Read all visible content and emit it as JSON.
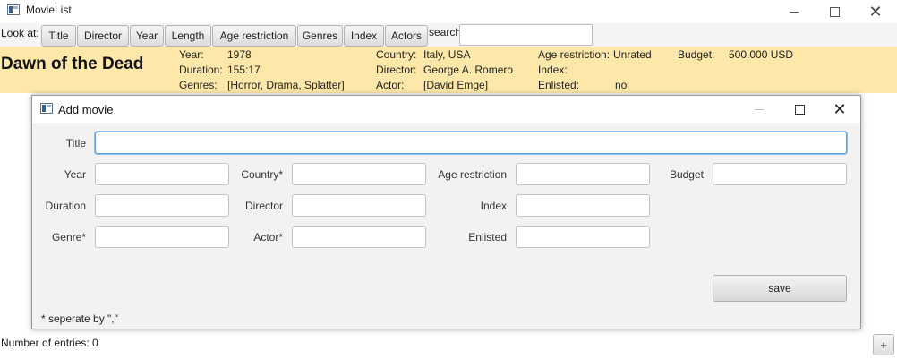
{
  "window": {
    "title": "MovieList",
    "icon": "app-window-icon",
    "controls": {
      "minimize": "minimize-icon",
      "maximize": "maximize-icon",
      "close": "✕"
    }
  },
  "toolbar": {
    "look_at_label": "Look at:",
    "buttons": [
      "Title",
      "Director",
      "Year",
      "Length",
      "Age restriction",
      "Genres",
      "Index",
      "Actors"
    ],
    "search_label": "search",
    "search_value": ""
  },
  "movie": {
    "title": "Dawn of the Dead",
    "year_label": "Year:",
    "year": "1978",
    "duration_label": "Duration:",
    "duration": "155:17",
    "genres_label": "Genres:",
    "genres": "[Horror,  Drama,  Splatter]",
    "country_label": "Country:",
    "country": "Italy, USA",
    "director_label": "Director:",
    "director": "George A. Romero",
    "actor_label": "Actor:",
    "actor": "[David Emge]",
    "age_label": "Age restriction:",
    "age": "Unrated",
    "index_label": "Index:",
    "index": "",
    "enlisted_label": "Enlisted:",
    "enlisted": "no",
    "budget_label": "Budget:",
    "budget": "500.000 USD",
    "highlight_color": "#fde8a9"
  },
  "dialog": {
    "title": "Add movie",
    "fields": {
      "title": {
        "label": "Title",
        "value": ""
      },
      "year": {
        "label": "Year",
        "value": ""
      },
      "country": {
        "label": "Country*",
        "value": ""
      },
      "age_restriction": {
        "label": "Age restriction",
        "value": ""
      },
      "budget": {
        "label": "Budget",
        "value": ""
      },
      "duration": {
        "label": "Duration",
        "value": ""
      },
      "director": {
        "label": "Director",
        "value": ""
      },
      "index": {
        "label": "Index",
        "value": ""
      },
      "genre": {
        "label": "Genre*",
        "value": ""
      },
      "actor": {
        "label": "Actor*",
        "value": ""
      },
      "enlisted": {
        "label": "Enlisted",
        "value": ""
      }
    },
    "save_label": "save",
    "note": "* seperate by \",\""
  },
  "status": {
    "entries_text": "Number of entries: 0",
    "add_label": "+"
  }
}
